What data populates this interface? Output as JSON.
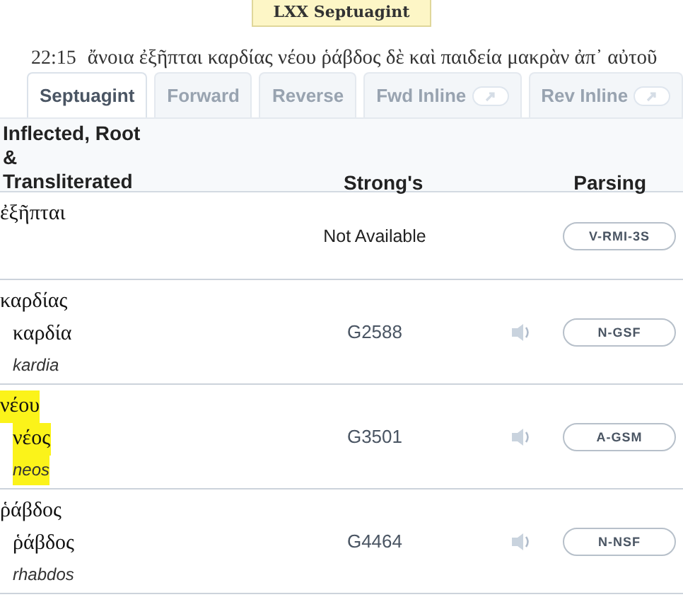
{
  "title": "LXX Septuagint",
  "verse": {
    "ref": "22:15",
    "text": "ἄνοια ἐξῆπται καρδίας νέου ῥάβδος δὲ καὶ παιδεία μακρὰν ἀπ᾽ αὐτοῦ"
  },
  "tabs": [
    {
      "label": "Septuagint",
      "selected": true,
      "kind": "plain"
    },
    {
      "label": "Forward",
      "selected": false,
      "kind": "plain"
    },
    {
      "label": "Reverse",
      "selected": false,
      "kind": "plain"
    },
    {
      "label": "Fwd Inline",
      "selected": false,
      "kind": "link"
    },
    {
      "label": "Rev Inline",
      "selected": false,
      "kind": "link"
    }
  ],
  "table": {
    "columns": [
      "Inflected, Root & Transliterated",
      "Strong's",
      "Parsing"
    ],
    "rows": [
      {
        "inflected": "ἐξῆπται",
        "strongs": "Not Available",
        "audio": false,
        "parsing": "V-RMI-3S",
        "highlighted": false
      },
      {
        "inflected": "καρδίας",
        "root": "καρδία",
        "translit": "kardia",
        "strongs": "G2588",
        "audio": true,
        "parsing": "N-GSF",
        "highlighted": false
      },
      {
        "inflected": "νέου",
        "root": "νέος",
        "translit": "neos",
        "strongs": "G3501",
        "audio": true,
        "parsing": "A-GSM",
        "highlighted": true
      },
      {
        "inflected": "ῥάβδος",
        "root": "ῥάβδος",
        "translit": "rhabdos",
        "strongs": "G4464",
        "audio": true,
        "parsing": "N-NSF",
        "highlighted": false
      }
    ]
  }
}
